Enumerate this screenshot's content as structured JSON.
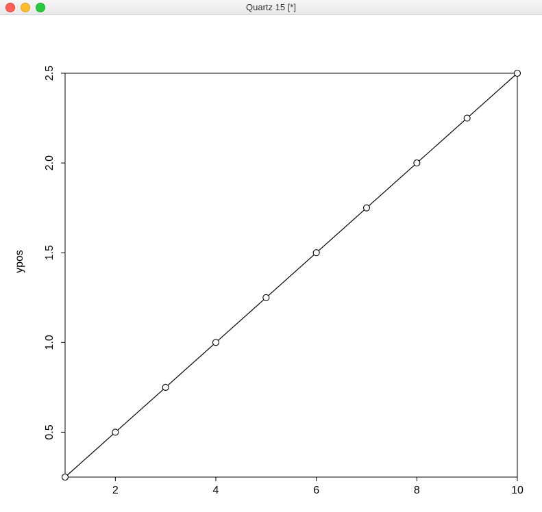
{
  "window": {
    "title": "Quartz 15 [*]"
  },
  "chart_data": {
    "type": "line",
    "x": [
      1,
      2,
      3,
      4,
      5,
      6,
      7,
      8,
      9,
      10
    ],
    "y": [
      0.25,
      0.5,
      0.75,
      1.0,
      1.25,
      1.5,
      1.75,
      2.0,
      2.25,
      2.5
    ],
    "points": true,
    "ylabel": "ypos",
    "xlabel": "",
    "title": "",
    "xlim": [
      1,
      10
    ],
    "ylim": [
      0.25,
      2.5
    ],
    "x_ticks": [
      2,
      4,
      6,
      8,
      10
    ],
    "y_ticks": [
      0.5,
      1.0,
      1.5,
      2.0,
      2.5
    ],
    "y_tick_labels": [
      "0.5",
      "1.0",
      "1.5",
      "2.0",
      "2.5"
    ]
  }
}
